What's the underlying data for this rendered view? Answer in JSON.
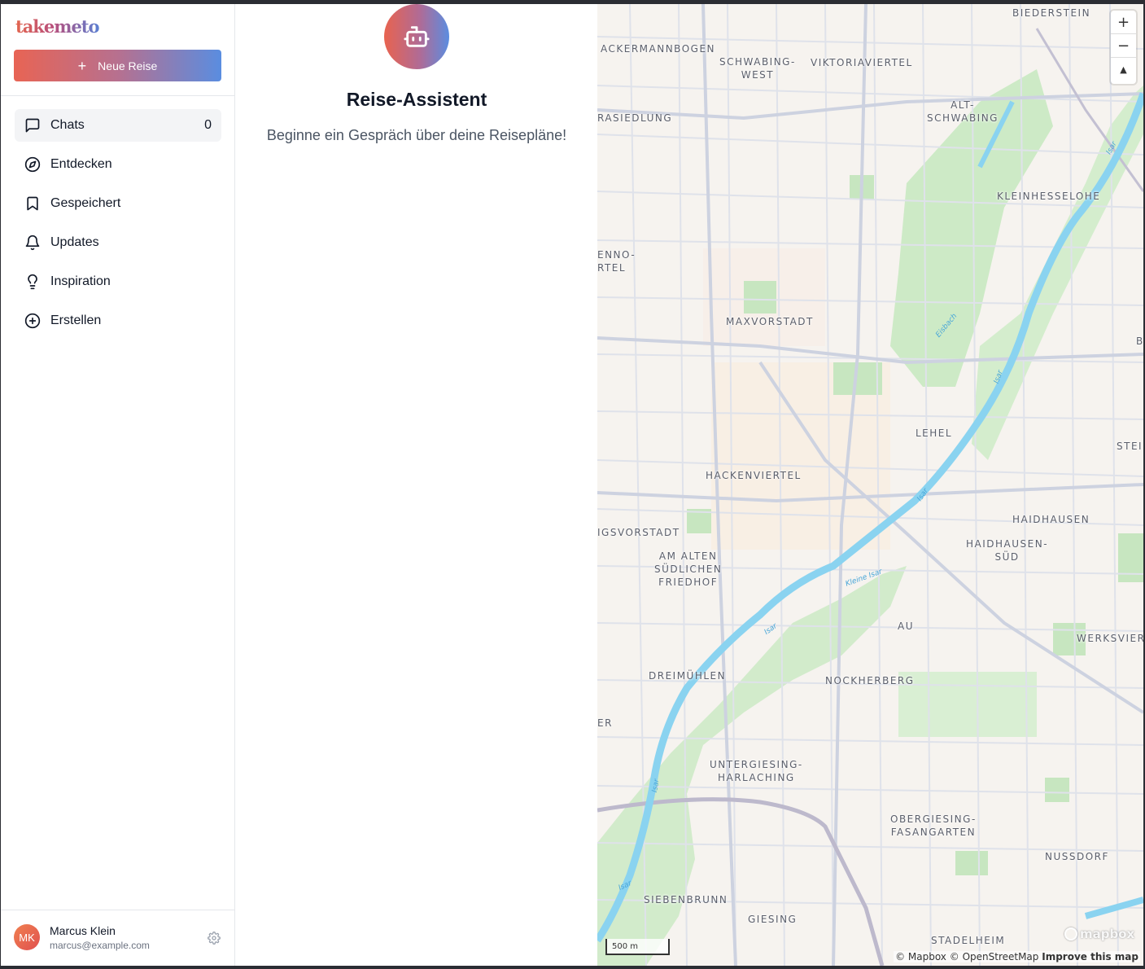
{
  "brand": {
    "logo_text": "takemeto"
  },
  "sidebar": {
    "new_trip_label": "Neue Reise",
    "items": [
      {
        "label": "Chats",
        "icon": "message-square-icon",
        "count": "0",
        "active": true
      },
      {
        "label": "Entdecken",
        "icon": "compass-icon"
      },
      {
        "label": "Gespeichert",
        "icon": "bookmark-icon"
      },
      {
        "label": "Updates",
        "icon": "bell-icon"
      },
      {
        "label": "Inspiration",
        "icon": "lightbulb-icon"
      },
      {
        "label": "Erstellen",
        "icon": "plus-circle-icon"
      }
    ],
    "user": {
      "initials": "MK",
      "name": "Marcus Klein",
      "email": "marcus@example.com"
    }
  },
  "chat": {
    "title": "Reise-Assistent",
    "subtitle": "Beginne ein Gespräch über deine Reisepläne!"
  },
  "map": {
    "labels": {
      "biederstein": "BIEDERSTEIN",
      "ackermannbogen": "ACKERMANNBOGEN",
      "schwabing_west": "SCHWABING-\nWEST",
      "viktoriaviertel": "VIKTORIAVIERTEL",
      "alt_schwabing": "ALT-\nSCHWABING",
      "siedlung": "RASIEDLUNG",
      "kleinhesselohe": "KLEINHESSELOHE",
      "enno": "ENNO-\nRTEL",
      "maxvorstadt": "MAXVORSTADT",
      "lehel": "LEHEL",
      "stei": "STEI",
      "hackenviertel": "HACKENVIERTEL",
      "haidhausen": "HAIDHAUSEN",
      "haidhausen_sued": "HAIDHAUSEN-\nSÜD",
      "igsvorstadt": "IGSVORSTADT",
      "alter_friedhof": "AM ALTEN\nSÜDLICHEN\nFRIEDHOF",
      "au": "AU",
      "werksviertel": "WERKSVIERTE",
      "dreimuehlen": "DREIMÜHLEN",
      "nockherberg": "NOCKHERBERG",
      "er": "ER",
      "untergiesing": "UNTERGIESING-\nHARLACHING",
      "obergiesing": "OBERGIESING-\nFASANGARTEN",
      "nussdorf": "NUSSDORF",
      "siebenbrunn": "SIEBENBRUNN",
      "giesing": "GIESING",
      "stadelheim": "STADELHEIM",
      "b": "B"
    },
    "water_labels": {
      "isar1": "Isar",
      "isar2": "Isar",
      "isar3": "Isar",
      "isar4": "Isar",
      "isar5": "Isar",
      "isar6": "Isar",
      "kleine_isar": "Kleine Isar",
      "eisbach": "Eisbach"
    },
    "zoom_in": "+",
    "zoom_out": "−",
    "compass": "▲",
    "scale_label": "500 m",
    "mapbox_logo": "mapbox",
    "attribution_mapbox": "© Mapbox",
    "attribution_osm": "© OpenStreetMap",
    "attribution_improve": "Improve this map"
  }
}
